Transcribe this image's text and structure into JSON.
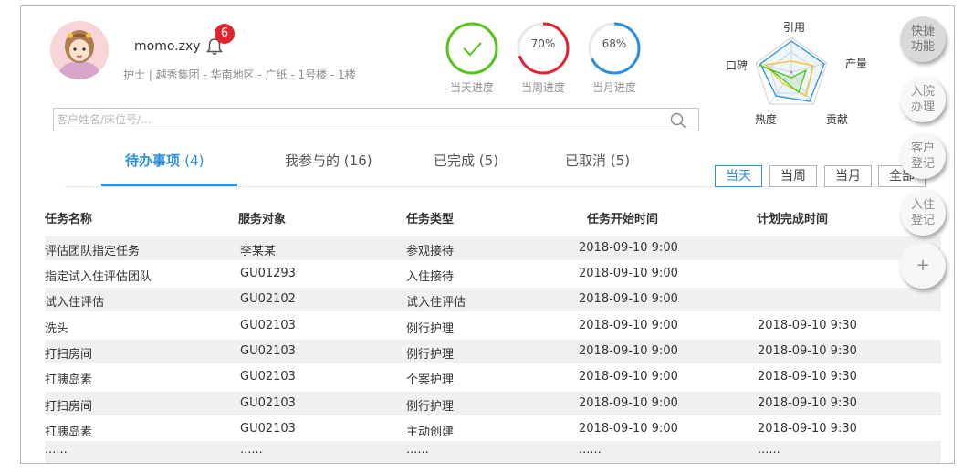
{
  "profile": {
    "username": "momo.zxy",
    "notification_count": "6",
    "meta": "护士 | 越秀集团 - 华南地区 - 广纸 - 1号楼 - 1楼"
  },
  "progress": [
    {
      "value_text": "",
      "label": "当天进度",
      "fraction": 1.0,
      "color": "#52c41a"
    },
    {
      "value_text": "70%",
      "label": "当周进度",
      "fraction": 0.7,
      "color": "#e0242b"
    },
    {
      "value_text": "68%",
      "label": "当月进度",
      "fraction": 0.68,
      "color": "#2a8fe0"
    }
  ],
  "radar": {
    "axes": [
      "引用",
      "产量",
      "贡献",
      "热度",
      "口碑"
    ]
  },
  "search": {
    "placeholder": "客户姓名/床位号/..."
  },
  "tabs": [
    {
      "label": "待办事项",
      "count": "(4)"
    },
    {
      "label": "我参与的",
      "count": "(16)"
    },
    {
      "label": "已完成",
      "count": "(5)"
    },
    {
      "label": "已取消",
      "count": "(5)"
    }
  ],
  "periods": [
    "当天",
    "当周",
    "当月",
    "全部"
  ],
  "table": {
    "headers": [
      "任务名称",
      "服务对象",
      "任务类型",
      "任务开始时间",
      "计划完成时间"
    ],
    "rows": [
      [
        "评估团队指定任务",
        "李某某",
        "参观接待",
        "2018-09-10 9:00",
        ""
      ],
      [
        "指定试入住评估团队",
        "GU01293",
        "入住接待",
        "2018-09-10 9:00",
        ""
      ],
      [
        "试入住评估",
        "GU02102",
        "试入住评估",
        "2018-09-10 9:00",
        ""
      ],
      [
        "洗头",
        "GU02103",
        "例行护理",
        "2018-09-10 9:00",
        "2018-09-10 9:30"
      ],
      [
        "打扫房间",
        "GU02103",
        "例行护理",
        "2018-09-10 9:00",
        "2018-09-10 9:30"
      ],
      [
        "打胰岛素",
        "GU02103",
        "个案护理",
        "2018-09-10 9:00",
        "2018-09-10 9:30"
      ],
      [
        "打扫房间",
        "GU02103",
        "例行护理",
        "2018-09-10 9:00",
        "2018-09-10 9:30"
      ],
      [
        "打胰岛素",
        "GU02103",
        "主动创建",
        "2018-09-10 9:00",
        "2018-09-10 9:30"
      ],
      [
        "......",
        "......",
        "......",
        "......",
        "......"
      ]
    ]
  },
  "quick_actions": [
    {
      "line1": "快捷",
      "line2": "功能"
    },
    {
      "line1": "入院",
      "line2": "办理"
    },
    {
      "line1": "客户",
      "line2": "登记"
    },
    {
      "line1": "入住",
      "line2": "登记"
    },
    {
      "line1": "+",
      "line2": ""
    }
  ]
}
